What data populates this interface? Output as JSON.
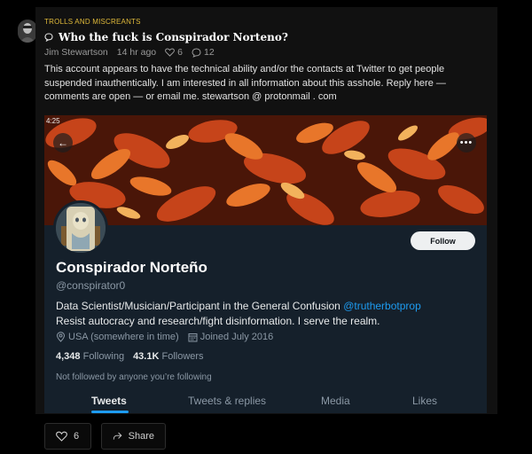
{
  "post": {
    "category": "TROLLS AND MISCREANTS",
    "title": "Who the fuck is Conspirador Norteno?",
    "author": "Jim Stewartson",
    "time_ago": "14 hr ago",
    "likes": "6",
    "comments": "12",
    "body": "This account appears to have the technical ability and/or the contacts at Twitter to get people suspended inauthentically. I am interested in all information about this asshole. Reply here — comments are open — or email me. stewartson @ protonmail . com"
  },
  "embed": {
    "time_fragment": "4:25",
    "profile": {
      "display_name": "Conspirador Norteño",
      "handle": "@conspirator0",
      "bio_text": "Data Scientist/Musician/Participant in the General Confusion",
      "bio_mention": "@trutherbotprop",
      "bio_line2": "Resist autocracy and research/fight disinformation. I serve the realm.",
      "location": "USA (somewhere in time)",
      "joined": "Joined July 2016",
      "following_count": "4,348",
      "following_label": "Following",
      "followers_count": "43.1K",
      "followers_label": "Followers",
      "not_followed": "Not followed by anyone you’re following",
      "follow_button": "Follow"
    },
    "tabs": [
      "Tweets",
      "Tweets & replies",
      "Media",
      "Likes"
    ],
    "active_tab": "Tweets",
    "colors": {
      "link": "#1d9bf0",
      "background": "#15202b"
    }
  },
  "actions": {
    "like_count": "6",
    "share_label": "Share"
  },
  "colors": {
    "category": "#e0ba3a"
  }
}
